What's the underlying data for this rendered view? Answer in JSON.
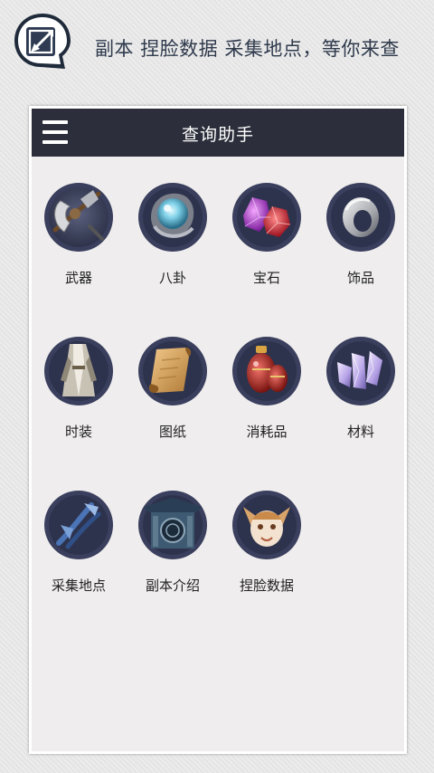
{
  "promo": {
    "tagline": "副本 捏脸数据 采集地点，等你来查",
    "logo_icon": "edit-square-arrow-icon"
  },
  "app": {
    "title": "查询助手",
    "menu_icon": "hamburger-menu-icon",
    "header_color": "#2c2f3b",
    "background_color": "#efeded"
  },
  "categories": [
    {
      "label": "武器",
      "icon": "weapon-axe-icon"
    },
    {
      "label": "八卦",
      "icon": "bagua-orb-icon"
    },
    {
      "label": "宝石",
      "icon": "gemstone-icon"
    },
    {
      "label": "饰品",
      "icon": "ring-icon"
    },
    {
      "label": "时装",
      "icon": "fashion-outfit-icon"
    },
    {
      "label": "图纸",
      "icon": "blueprint-scroll-icon"
    },
    {
      "label": "消耗品",
      "icon": "potion-jar-icon"
    },
    {
      "label": "材料",
      "icon": "crystal-material-icon"
    },
    {
      "label": "采集地点",
      "icon": "gather-tool-icon"
    },
    {
      "label": "副本介绍",
      "icon": "dungeon-gate-icon"
    },
    {
      "label": "捏脸数据",
      "icon": "face-mask-icon"
    }
  ]
}
